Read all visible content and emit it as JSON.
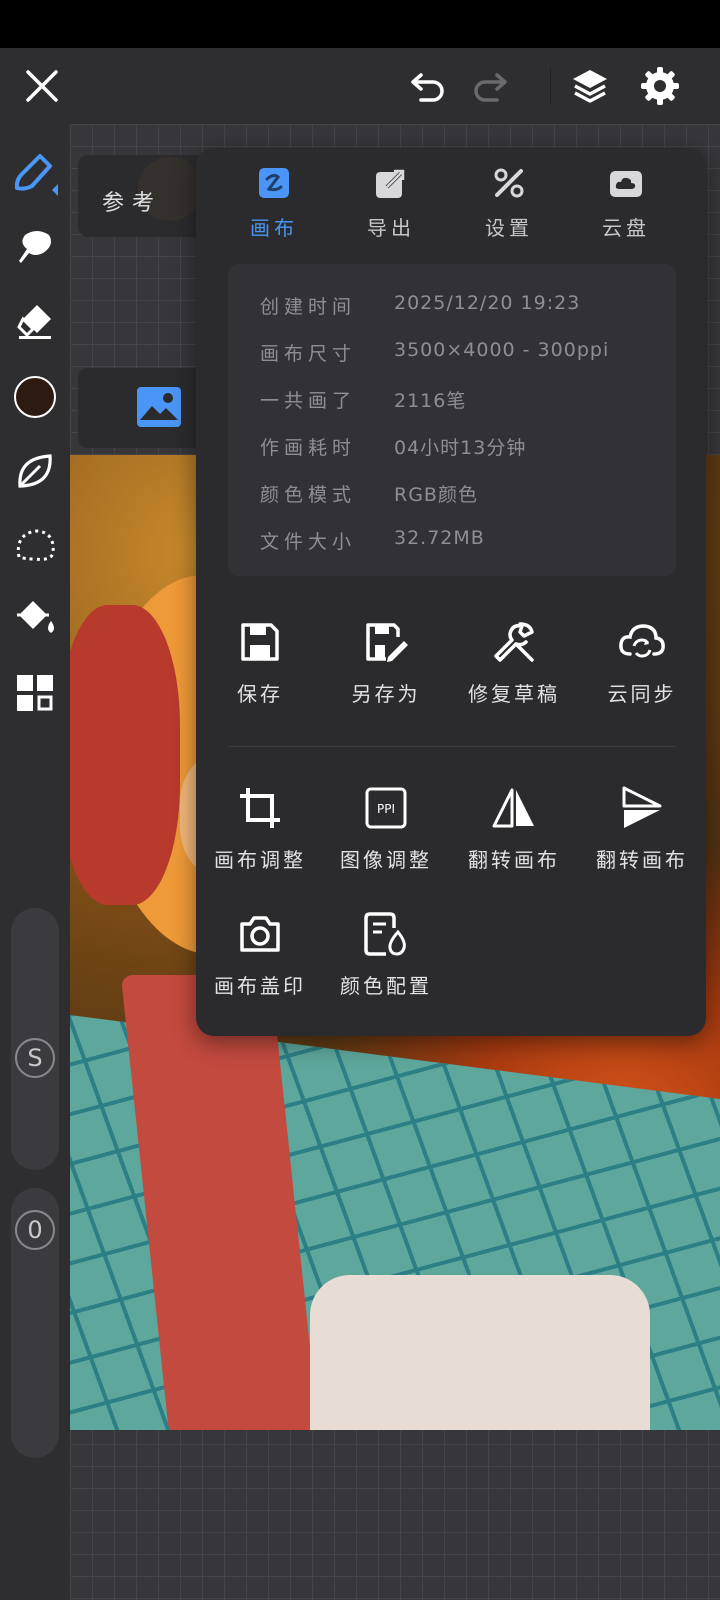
{
  "toolbar": {
    "icons": [
      "close-icon",
      "undo-icon",
      "redo-icon",
      "layers-icon",
      "settings-icon"
    ]
  },
  "left_tools": {
    "icons": [
      "brush-icon",
      "smudge-icon",
      "eraser-icon",
      "color-swatch",
      "leaf-icon",
      "lasso-icon",
      "fill-bucket-icon",
      "grid-icon"
    ],
    "current_color": "#2d1a10",
    "size_slider_label": "S",
    "opacity_slider_label": "0"
  },
  "reference": {
    "label": "参考"
  },
  "popover": {
    "tabs": [
      {
        "label": "画布",
        "icon": "canvas-icon",
        "active": true
      },
      {
        "label": "导出",
        "icon": "export-icon",
        "active": false
      },
      {
        "label": "设置",
        "icon": "tools-icon",
        "active": false
      },
      {
        "label": "云盘",
        "icon": "cloud-drive-icon",
        "active": false
      }
    ],
    "info": [
      {
        "key": "创建时间",
        "value": "2025/12/20 19:23"
      },
      {
        "key": "画布尺寸",
        "value": "3500×4000 - 300ppi"
      },
      {
        "key": "一共画了",
        "value": "2116笔"
      },
      {
        "key": "作画耗时",
        "value": "04小时13分钟"
      },
      {
        "key": "颜色模式",
        "value": "RGB颜色"
      },
      {
        "key": "文件大小",
        "value": "32.72MB"
      }
    ],
    "actions_row1": [
      {
        "label": "保存",
        "icon": "save-icon"
      },
      {
        "label": "另存为",
        "icon": "save-as-icon"
      },
      {
        "label": "修复草稿",
        "icon": "wrench-icon"
      },
      {
        "label": "云同步",
        "icon": "cloud-sync-icon"
      }
    ],
    "actions_row2": [
      {
        "label": "画布调整",
        "icon": "crop-icon"
      },
      {
        "label": "图像调整",
        "icon": "ppi-icon"
      },
      {
        "label": "翻转画布",
        "icon": "flip-horizontal-icon"
      },
      {
        "label": "翻转画布",
        "icon": "flip-vertical-icon"
      }
    ],
    "actions_row3": [
      {
        "label": "画布盖印",
        "icon": "camera-icon"
      },
      {
        "label": "颜色配置",
        "icon": "color-profile-icon"
      }
    ],
    "accent_color": "#4a95f5"
  }
}
